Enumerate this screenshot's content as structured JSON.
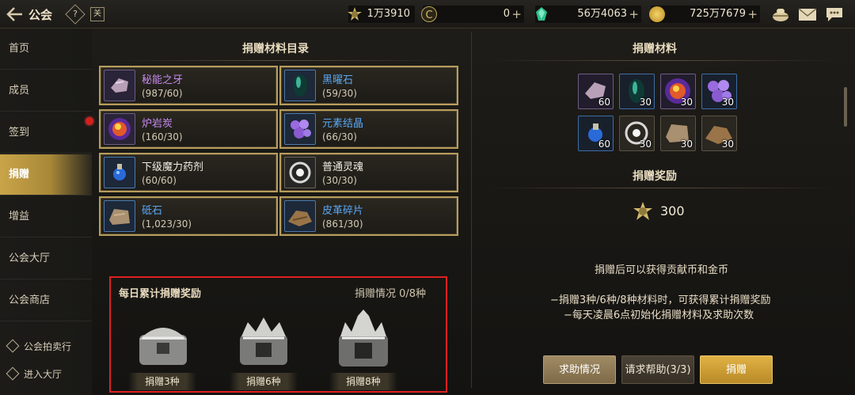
{
  "topbar": {
    "title": "公会",
    "help_glyph": "?",
    "book_glyph": "关",
    "resources": [
      {
        "icon": "contribution-medal-icon",
        "value": "1万3910",
        "has_plus": false
      },
      {
        "icon": "c-coin-icon",
        "value": "0",
        "has_plus": true
      },
      {
        "icon": "green-gem-icon",
        "value": "56万4063",
        "has_plus": true
      },
      {
        "icon": "gold-coin-icon",
        "value": "725万7679",
        "has_plus": true
      }
    ],
    "plus": "+",
    "right_icons": [
      "treasure-bowl-icon",
      "mail-icon",
      "chat-icon"
    ]
  },
  "sidebar": {
    "items": [
      {
        "label": "首页",
        "active": false
      },
      {
        "label": "成员",
        "active": false
      },
      {
        "label": "签到",
        "active": false
      },
      {
        "label": "捐赠",
        "active": true
      },
      {
        "label": "增益",
        "active": false
      },
      {
        "label": "公会大厅",
        "active": false
      },
      {
        "label": "公会商店",
        "active": false
      }
    ],
    "auction_label": "公会拍卖行",
    "enter_hall_label": "进入大厅"
  },
  "catalog": {
    "title": "捐赠材料目录",
    "materials": [
      {
        "name": "秘能之牙",
        "count": "(987/60)",
        "rarity": "purple",
        "icon": "fang-icon"
      },
      {
        "name": "黑曜石",
        "count": "(59/30)",
        "rarity": "blue",
        "icon": "obsidian-icon"
      },
      {
        "name": "炉岩炭",
        "count": "(160/30)",
        "rarity": "purple",
        "icon": "lava-orb-icon"
      },
      {
        "name": "元素结晶",
        "count": "(66/30)",
        "rarity": "blue",
        "icon": "crystal-cluster-icon"
      },
      {
        "name": "下级魔力药剂",
        "count": "(60/60)",
        "rarity": "white",
        "icon": "potion-icon"
      },
      {
        "name": "普通灵魂",
        "count": "(30/30)",
        "rarity": "white",
        "icon": "soul-icon"
      },
      {
        "name": "砥石",
        "count": "(1,023/30)",
        "rarity": "blue",
        "icon": "whetstone-icon"
      },
      {
        "name": "皮革碎片",
        "count": "(861/30)",
        "rarity": "blue",
        "icon": "leather-icon"
      }
    ]
  },
  "daily": {
    "title": "每日累计捐赠奖励",
    "status": "捐赠情况 0/8种",
    "chests": [
      {
        "label": "捐赠3种",
        "icon": "silver-chest-icon"
      },
      {
        "label": "捐赠6种",
        "icon": "crown-chest-icon"
      },
      {
        "label": "捐赠8种",
        "icon": "spiked-chest-icon"
      }
    ]
  },
  "donate": {
    "title": "捐赠材料",
    "slots": [
      {
        "icon": "fang-icon",
        "count": "60",
        "rarity": "purple"
      },
      {
        "icon": "obsidian-icon",
        "count": "30",
        "rarity": "blue"
      },
      {
        "icon": "lava-orb-icon",
        "count": "30",
        "rarity": "purple"
      },
      {
        "icon": "crystal-cluster-icon",
        "count": "30",
        "rarity": "blue"
      },
      {
        "icon": "potion-icon",
        "count": "60",
        "rarity": "blue"
      },
      {
        "icon": "soul-icon",
        "count": "30",
        "rarity": "white"
      },
      {
        "icon": "whetstone-icon",
        "count": "30",
        "rarity": "white"
      },
      {
        "icon": "leather-icon",
        "count": "30",
        "rarity": "white"
      }
    ],
    "reward_title": "捐赠奖励",
    "reward_value": "300",
    "info1": "捐赠后可以获得贡献币和金币",
    "info2": "−捐赠3种/6种/8种材料时，可获得累计捐赠奖励",
    "info3": "−每天凌晨6点初始化捐赠材料及求助次数",
    "buttons": {
      "help_status": "求助情况",
      "request_help": "请求帮助(3/3)",
      "donate": "捐赠"
    }
  },
  "colors": {
    "accent_gold": "#c9a449",
    "card_border": "#b79d5c",
    "purple_text": "#c58af0",
    "blue_text": "#58a8f5",
    "highlight_red": "#e02020"
  }
}
